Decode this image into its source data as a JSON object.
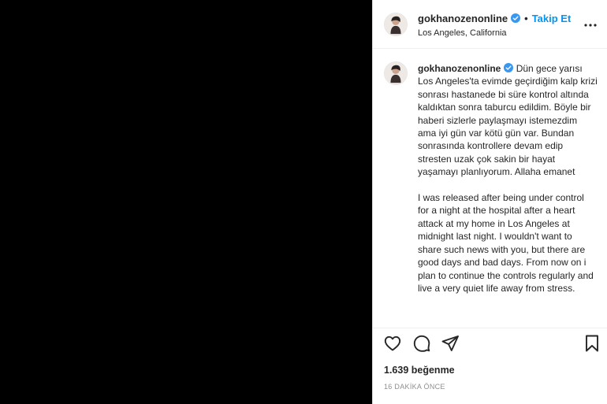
{
  "post": {
    "username": "gokhanozenonline",
    "follow_label": "Takip Et",
    "separator": "•",
    "location": "Los Angeles, California",
    "caption": "Dün gece yarısı Los Angeles'ta evimde geçirdiğim kalp krizi sonrası hastanede bi süre kontrol altında kaldıktan sonra taburcu edildim. Böyle bir haberi sizlerle paylaşmayı istemezdim ama iyi gün var kötü gün var. Bundan sonrasında kontrollere devam edip stresten uzak çok sakin bir hayat yaşamayı planlıyorum. Allaha emanet\n\nI was released after being under control for a night at the hospital after a heart attack at my home in Los Angeles at midnight last night. I wouldn't want to share such news with you, but there are good days and bad days. From now on i plan to continue the controls regularly and live a very quiet life away from stress.",
    "likes": "1.639 beğenme",
    "timestamp": "16 DAKİKA ÖNCE"
  },
  "icons": {
    "verified": "verified-badge-icon",
    "more": "more-options-icon",
    "like": "heart-icon",
    "comment": "comment-icon",
    "share": "send-icon",
    "save": "bookmark-icon"
  },
  "colors": {
    "link": "#0095f6",
    "verified": "#3897f0",
    "media_background": "#000000",
    "muted_text": "#8e8e8e"
  }
}
